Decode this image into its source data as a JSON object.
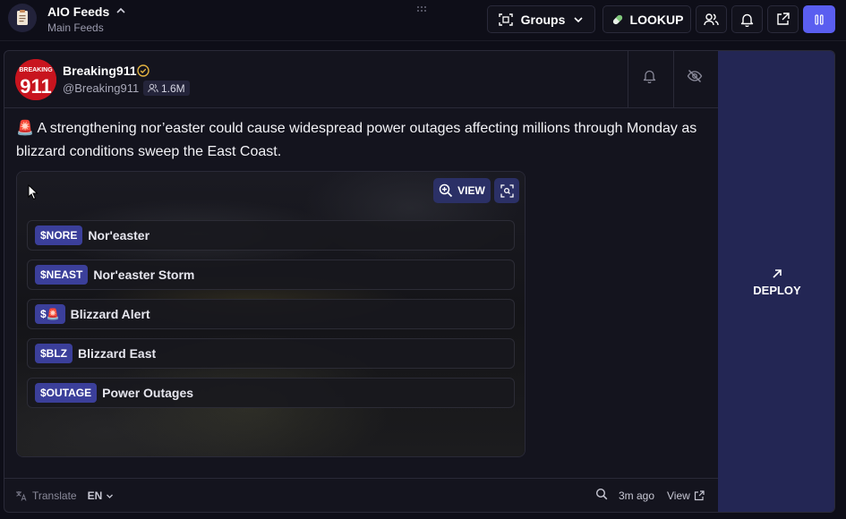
{
  "header": {
    "title": "AIO Feeds",
    "subtitle": "Main Feeds",
    "groups_label": "Groups",
    "lookup_label": "LOOKUP"
  },
  "post": {
    "author": "Breaking911",
    "handle": "@Breaking911",
    "followers": "1.6M",
    "text": "🚨 A strengthening nor’easter could cause widespread power outages affecting millions through Monday as blizzard conditions sweep the East Coast.",
    "view_label": "VIEW",
    "tickers": [
      {
        "symbol": "$NORE",
        "name": "Nor'easter"
      },
      {
        "symbol": "$NEAST",
        "name": "Nor'easter Storm"
      },
      {
        "symbol": "$🚨",
        "name": "Blizzard Alert"
      },
      {
        "symbol": "$BLZ",
        "name": "Blizzard East"
      },
      {
        "symbol": "$OUTAGE",
        "name": "Power Outages"
      }
    ]
  },
  "footer": {
    "translate_label": "Translate",
    "language": "EN",
    "time": "3m ago",
    "view_link": "View"
  },
  "deploy_label": "DEPLOY",
  "colors": {
    "accent": "#5a5ef0",
    "badge": "#3b3f9a",
    "deploy_bg": "#232654",
    "verified": "#e3b341"
  }
}
